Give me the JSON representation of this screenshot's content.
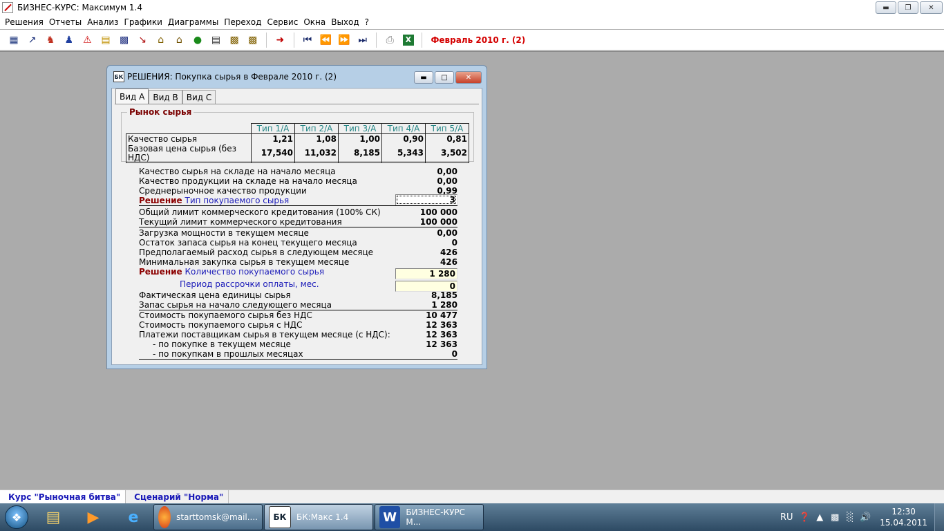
{
  "app": {
    "title": "БИЗНЕС-КУРС: Максимум 1.4"
  },
  "menu": [
    "Решения",
    "Отчеты",
    "Анализ",
    "Графики",
    "Диаграммы",
    "Переход",
    "Сервис",
    "Окна",
    "Выход",
    "?"
  ],
  "toolbar": {
    "icons": [
      "decisions-icon",
      "chart-up-icon",
      "people-icon",
      "staff-icon",
      "warning-icon",
      "folder-icon",
      "factory-icon",
      "warehouse-icon",
      "house-icon",
      "money-bag-icon",
      "document-icon",
      "plan-icon",
      "stock-icon"
    ],
    "period": "Февраль 2010 г. (2)"
  },
  "dialog": {
    "title": "РЕШЕНИЯ: Покупка сырья в Феврале 2010 г. (2)",
    "icon_text": "БК",
    "tabs": [
      "Вид А",
      "Вид В",
      "Вид С"
    ],
    "group_title": "Рынок сырья",
    "table": {
      "headers": [
        "Тип 1/А",
        "Тип 2/А",
        "Тип 3/А",
        "Тип 4/А",
        "Тип 5/А"
      ],
      "rows": [
        {
          "label": "Качество сырья",
          "values": [
            "1,21",
            "1,08",
            "1,00",
            "0,90",
            "0,81"
          ]
        },
        {
          "label": "Базовая цена сырья (без НДС)",
          "values": [
            "17,540",
            "11,032",
            "8,185",
            "5,343",
            "3,502"
          ]
        }
      ]
    },
    "rows": [
      {
        "label": "Качество сырья на складе на начало месяца",
        "value": "0,00"
      },
      {
        "label": "Качество продукции на складе на начало месяца",
        "value": "0,00"
      },
      {
        "label": "Среднерыночное качество продукции",
        "value": "0,99"
      },
      {
        "decision": "Решение",
        "label": "Тип покупаемого сырья",
        "value": "3"
      },
      {
        "label": "Общий лимит коммерческого кредитования (100% СК)",
        "value": "100 000"
      },
      {
        "label": "Текущий лимит коммерческого кредитования",
        "value": "100 000"
      },
      {
        "label": "Загрузка мощности в текущем месяце",
        "value": "0,00"
      },
      {
        "label": "Остаток запаса сырья на конец текущего месяца",
        "value": "0"
      },
      {
        "label": "Предполагаемый расход сырья в следующем месяце",
        "value": "426"
      },
      {
        "label": "Минимальная закупка сырья в текущем месяце",
        "value": "426"
      },
      {
        "decision": "Решение",
        "label": "Количество покупаемого сырья",
        "value": "1 280"
      },
      {
        "label": "Период рассрочки оплаты, мес.",
        "value": "0"
      },
      {
        "label": "Фактическая цена единицы сырья",
        "value": "8,185"
      },
      {
        "label": "Запас сырья на начало следующего месяца",
        "value": "1 280"
      },
      {
        "label": "Стоимость покупаемого сырья без НДС",
        "value": "10 477"
      },
      {
        "label": "Стоимость покупаемого сырья с НДС",
        "value": "12 363"
      },
      {
        "label": "Платежи поставщикам сырья в текущем месяце (с НДС):",
        "value": "12 363"
      },
      {
        "label": "- по покупке в текущем месяце",
        "value": "12 363"
      },
      {
        "label": "- по покупкам в прошлых месяцах",
        "value": "0"
      }
    ]
  },
  "bottom_tabs": [
    "Курс \"Рыночная битва\"",
    "Сценарий \"Норма\""
  ],
  "taskbar": {
    "tasks": [
      {
        "label": "starttomsk@mail...."
      },
      {
        "label": "БК:Макс 1.4",
        "icon_text": "БК"
      },
      {
        "label": "БИЗНЕС-КУРС М...",
        "icon_text": "W"
      }
    ],
    "tray": {
      "lang": "RU",
      "time": "12:30",
      "date": "15.04.2011"
    }
  },
  "colors": {
    "period": "#d40000",
    "decision": "#8b0000",
    "blue_label": "#1a1ab8",
    "header_teal": "#238585",
    "workspace": "#ababab"
  }
}
